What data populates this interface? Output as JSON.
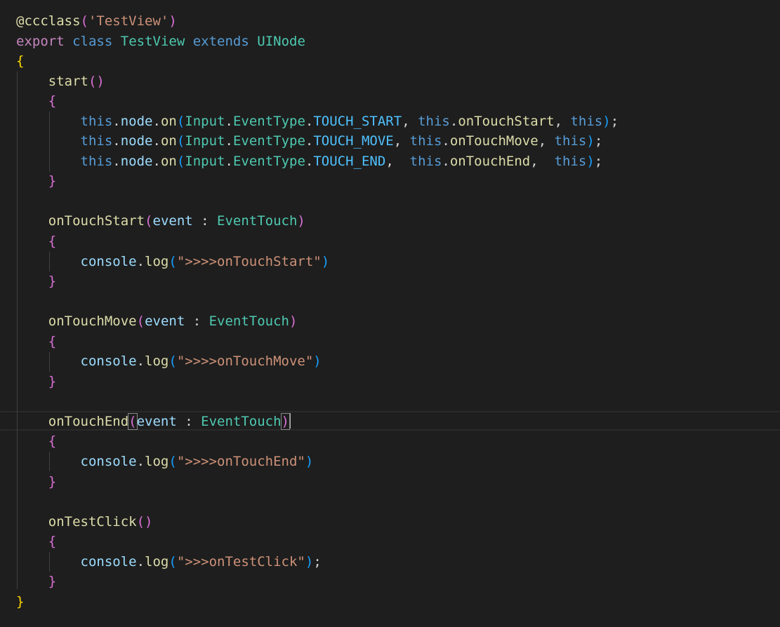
{
  "colors": {
    "background": "#1e1e1e",
    "default": "#d4d4d4",
    "keyword": "#c586c0",
    "storage": "#569cd6",
    "class_name": "#4ec9b0",
    "function": "#dcdcaa",
    "property": "#9cdcfe",
    "string": "#ce9178",
    "constant": "#4fc1ff",
    "bracket_gold": "#ffd700",
    "bracket_pink": "#da70d6",
    "bracket_blue": "#179fff",
    "param": "#9cdcfe"
  },
  "code_lines": [
    [
      [
        "@ccclass",
        "function"
      ],
      [
        "(",
        "bracket_pink"
      ],
      [
        "'TestView'",
        "string"
      ],
      [
        ")",
        "bracket_pink"
      ]
    ],
    [
      [
        "export",
        "keyword"
      ],
      [
        " ",
        "default"
      ],
      [
        "class",
        "storage"
      ],
      [
        " ",
        "default"
      ],
      [
        "TestView",
        "class_name"
      ],
      [
        " ",
        "default"
      ],
      [
        "extends",
        "storage"
      ],
      [
        " ",
        "default"
      ],
      [
        "UINode",
        "class_name"
      ]
    ],
    [
      [
        "{",
        "bracket_gold"
      ]
    ],
    [
      [
        "    ",
        "default"
      ],
      [
        "start",
        "function"
      ],
      [
        "()",
        "bracket_pink"
      ]
    ],
    [
      [
        "    ",
        "default"
      ],
      [
        "{",
        "bracket_pink"
      ]
    ],
    [
      [
        "        ",
        "default"
      ],
      [
        "this",
        "storage"
      ],
      [
        ".",
        "default"
      ],
      [
        "node",
        "property"
      ],
      [
        ".",
        "default"
      ],
      [
        "on",
        "function"
      ],
      [
        "(",
        "bracket_blue"
      ],
      [
        "Input",
        "class_name"
      ],
      [
        ".",
        "default"
      ],
      [
        "EventType",
        "class_name"
      ],
      [
        ".",
        "default"
      ],
      [
        "TOUCH_START",
        "constant"
      ],
      [
        ", ",
        "default"
      ],
      [
        "this",
        "storage"
      ],
      [
        ".",
        "default"
      ],
      [
        "onTouchStart",
        "function"
      ],
      [
        ", ",
        "default"
      ],
      [
        "this",
        "storage"
      ],
      [
        ")",
        "bracket_blue"
      ],
      [
        ";",
        "default"
      ]
    ],
    [
      [
        "        ",
        "default"
      ],
      [
        "this",
        "storage"
      ],
      [
        ".",
        "default"
      ],
      [
        "node",
        "property"
      ],
      [
        ".",
        "default"
      ],
      [
        "on",
        "function"
      ],
      [
        "(",
        "bracket_blue"
      ],
      [
        "Input",
        "class_name"
      ],
      [
        ".",
        "default"
      ],
      [
        "EventType",
        "class_name"
      ],
      [
        ".",
        "default"
      ],
      [
        "TOUCH_MOVE",
        "constant"
      ],
      [
        ", ",
        "default"
      ],
      [
        "this",
        "storage"
      ],
      [
        ".",
        "default"
      ],
      [
        "onTouchMove",
        "function"
      ],
      [
        ", ",
        "default"
      ],
      [
        "this",
        "storage"
      ],
      [
        ")",
        "bracket_blue"
      ],
      [
        ";",
        "default"
      ]
    ],
    [
      [
        "        ",
        "default"
      ],
      [
        "this",
        "storage"
      ],
      [
        ".",
        "default"
      ],
      [
        "node",
        "property"
      ],
      [
        ".",
        "default"
      ],
      [
        "on",
        "function"
      ],
      [
        "(",
        "bracket_blue"
      ],
      [
        "Input",
        "class_name"
      ],
      [
        ".",
        "default"
      ],
      [
        "EventType",
        "class_name"
      ],
      [
        ".",
        "default"
      ],
      [
        "TOUCH_END",
        "constant"
      ],
      [
        ",  ",
        "default"
      ],
      [
        "this",
        "storage"
      ],
      [
        ".",
        "default"
      ],
      [
        "onTouchEnd",
        "function"
      ],
      [
        ",  ",
        "default"
      ],
      [
        "this",
        "storage"
      ],
      [
        ")",
        "bracket_blue"
      ],
      [
        ";",
        "default"
      ]
    ],
    [
      [
        "    ",
        "default"
      ],
      [
        "}",
        "bracket_pink"
      ]
    ],
    [],
    [
      [
        "    ",
        "default"
      ],
      [
        "onTouchStart",
        "function"
      ],
      [
        "(",
        "bracket_pink"
      ],
      [
        "event",
        "param"
      ],
      [
        " : ",
        "default"
      ],
      [
        "EventTouch",
        "class_name"
      ],
      [
        ")",
        "bracket_pink"
      ]
    ],
    [
      [
        "    ",
        "default"
      ],
      [
        "{",
        "bracket_pink"
      ]
    ],
    [
      [
        "        ",
        "default"
      ],
      [
        "console",
        "property"
      ],
      [
        ".",
        "default"
      ],
      [
        "log",
        "function"
      ],
      [
        "(",
        "bracket_blue"
      ],
      [
        "\">>>>onTouchStart\"",
        "string"
      ],
      [
        ")",
        "bracket_blue"
      ]
    ],
    [
      [
        "    ",
        "default"
      ],
      [
        "}",
        "bracket_pink"
      ]
    ],
    [],
    [
      [
        "    ",
        "default"
      ],
      [
        "onTouchMove",
        "function"
      ],
      [
        "(",
        "bracket_pink"
      ],
      [
        "event",
        "param"
      ],
      [
        " : ",
        "default"
      ],
      [
        "EventTouch",
        "class_name"
      ],
      [
        ")",
        "bracket_pink"
      ]
    ],
    [
      [
        "    ",
        "default"
      ],
      [
        "{",
        "bracket_pink"
      ]
    ],
    [
      [
        "        ",
        "default"
      ],
      [
        "console",
        "property"
      ],
      [
        ".",
        "default"
      ],
      [
        "log",
        "function"
      ],
      [
        "(",
        "bracket_blue"
      ],
      [
        "\">>>>onTouchMove\"",
        "string"
      ],
      [
        ")",
        "bracket_blue"
      ]
    ],
    [
      [
        "    ",
        "default"
      ],
      [
        "}",
        "bracket_pink"
      ]
    ],
    [],
    [
      [
        "    ",
        "default"
      ],
      [
        "onTouchEnd",
        "function"
      ],
      [
        "(",
        "bracket_pink",
        "bm"
      ],
      [
        "event",
        "param"
      ],
      [
        " : ",
        "default"
      ],
      [
        "EventTouch",
        "class_name"
      ],
      [
        ")",
        "bracket_pink",
        "bm"
      ],
      [
        "",
        "cursor"
      ]
    ],
    [
      [
        "    ",
        "default"
      ],
      [
        "{",
        "bracket_pink"
      ]
    ],
    [
      [
        "        ",
        "default"
      ],
      [
        "console",
        "property"
      ],
      [
        ".",
        "default"
      ],
      [
        "log",
        "function"
      ],
      [
        "(",
        "bracket_blue"
      ],
      [
        "\">>>>onTouchEnd\"",
        "string"
      ],
      [
        ")",
        "bracket_blue"
      ]
    ],
    [
      [
        "    ",
        "default"
      ],
      [
        "}",
        "bracket_pink"
      ]
    ],
    [],
    [
      [
        "    ",
        "default"
      ],
      [
        "onTestClick",
        "function"
      ],
      [
        "()",
        "bracket_pink"
      ]
    ],
    [
      [
        "    ",
        "default"
      ],
      [
        "{",
        "bracket_pink"
      ]
    ],
    [
      [
        "        ",
        "default"
      ],
      [
        "console",
        "property"
      ],
      [
        ".",
        "default"
      ],
      [
        "log",
        "function"
      ],
      [
        "(",
        "bracket_blue"
      ],
      [
        "\">>>onTestClick\"",
        "string"
      ],
      [
        ")",
        "bracket_blue"
      ],
      [
        ";",
        "default"
      ]
    ],
    [
      [
        "    ",
        "default"
      ],
      [
        "}",
        "bracket_pink"
      ]
    ],
    [
      [
        "}",
        "bracket_gold"
      ]
    ]
  ]
}
